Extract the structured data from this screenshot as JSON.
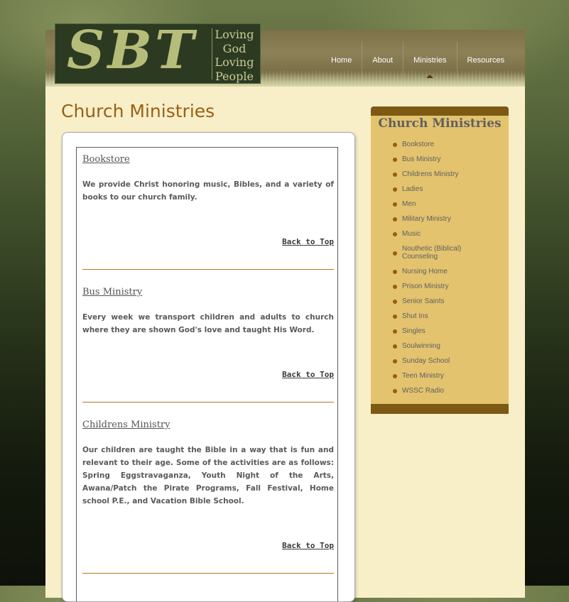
{
  "logo": {
    "mark": "SBT",
    "tagline": [
      "Loving",
      "God",
      "Loving",
      "People"
    ]
  },
  "nav": {
    "items": [
      {
        "label": "Home"
      },
      {
        "label": "About"
      },
      {
        "label": "Ministries",
        "active": true
      },
      {
        "label": "Resources"
      }
    ]
  },
  "page_title": "Church Ministries",
  "sections": [
    {
      "title": "Bookstore",
      "body": "We provide Christ honoring music, Bibles, and a variety of books to our church family.",
      "back_label": "Back to Top"
    },
    {
      "title": "Bus Ministry",
      "body": "Every week we transport children and adults to church where they are shown God's love and taught His Word.",
      "back_label": "Back to Top"
    },
    {
      "title": "Childrens Ministry",
      "body": "Our children are taught the Bible in a way that is fun and relevant to their age. Some of the activities are as follows: Spring Eggstravaganza, Youth Night of the Arts, Awana/Patch the Pirate Programs, Fall Festival, Home school P.E., and Vacation Bible School.",
      "back_label": "Back to Top"
    }
  ],
  "sidebar": {
    "title": "Church Ministries",
    "items": [
      "Bookstore",
      "Bus Ministry",
      "Childrens Ministry",
      "Ladies",
      "Men",
      "Military Ministry",
      "Music",
      "Nouthetic (Biblical) Counseling",
      "Nursing Home",
      "Prison Ministry",
      "Senior Saints",
      "Shut Ins",
      "Singles",
      "Soulwinning",
      "Sunday School",
      "Teen Ministry",
      "WSSC Radio"
    ]
  },
  "colors": {
    "accent": "#9a5f16",
    "sidebar_bg": "#e3c36e",
    "sidebar_bar": "#7c5a14",
    "content_bg": "#f8efc9",
    "rule": "#b07a22"
  }
}
